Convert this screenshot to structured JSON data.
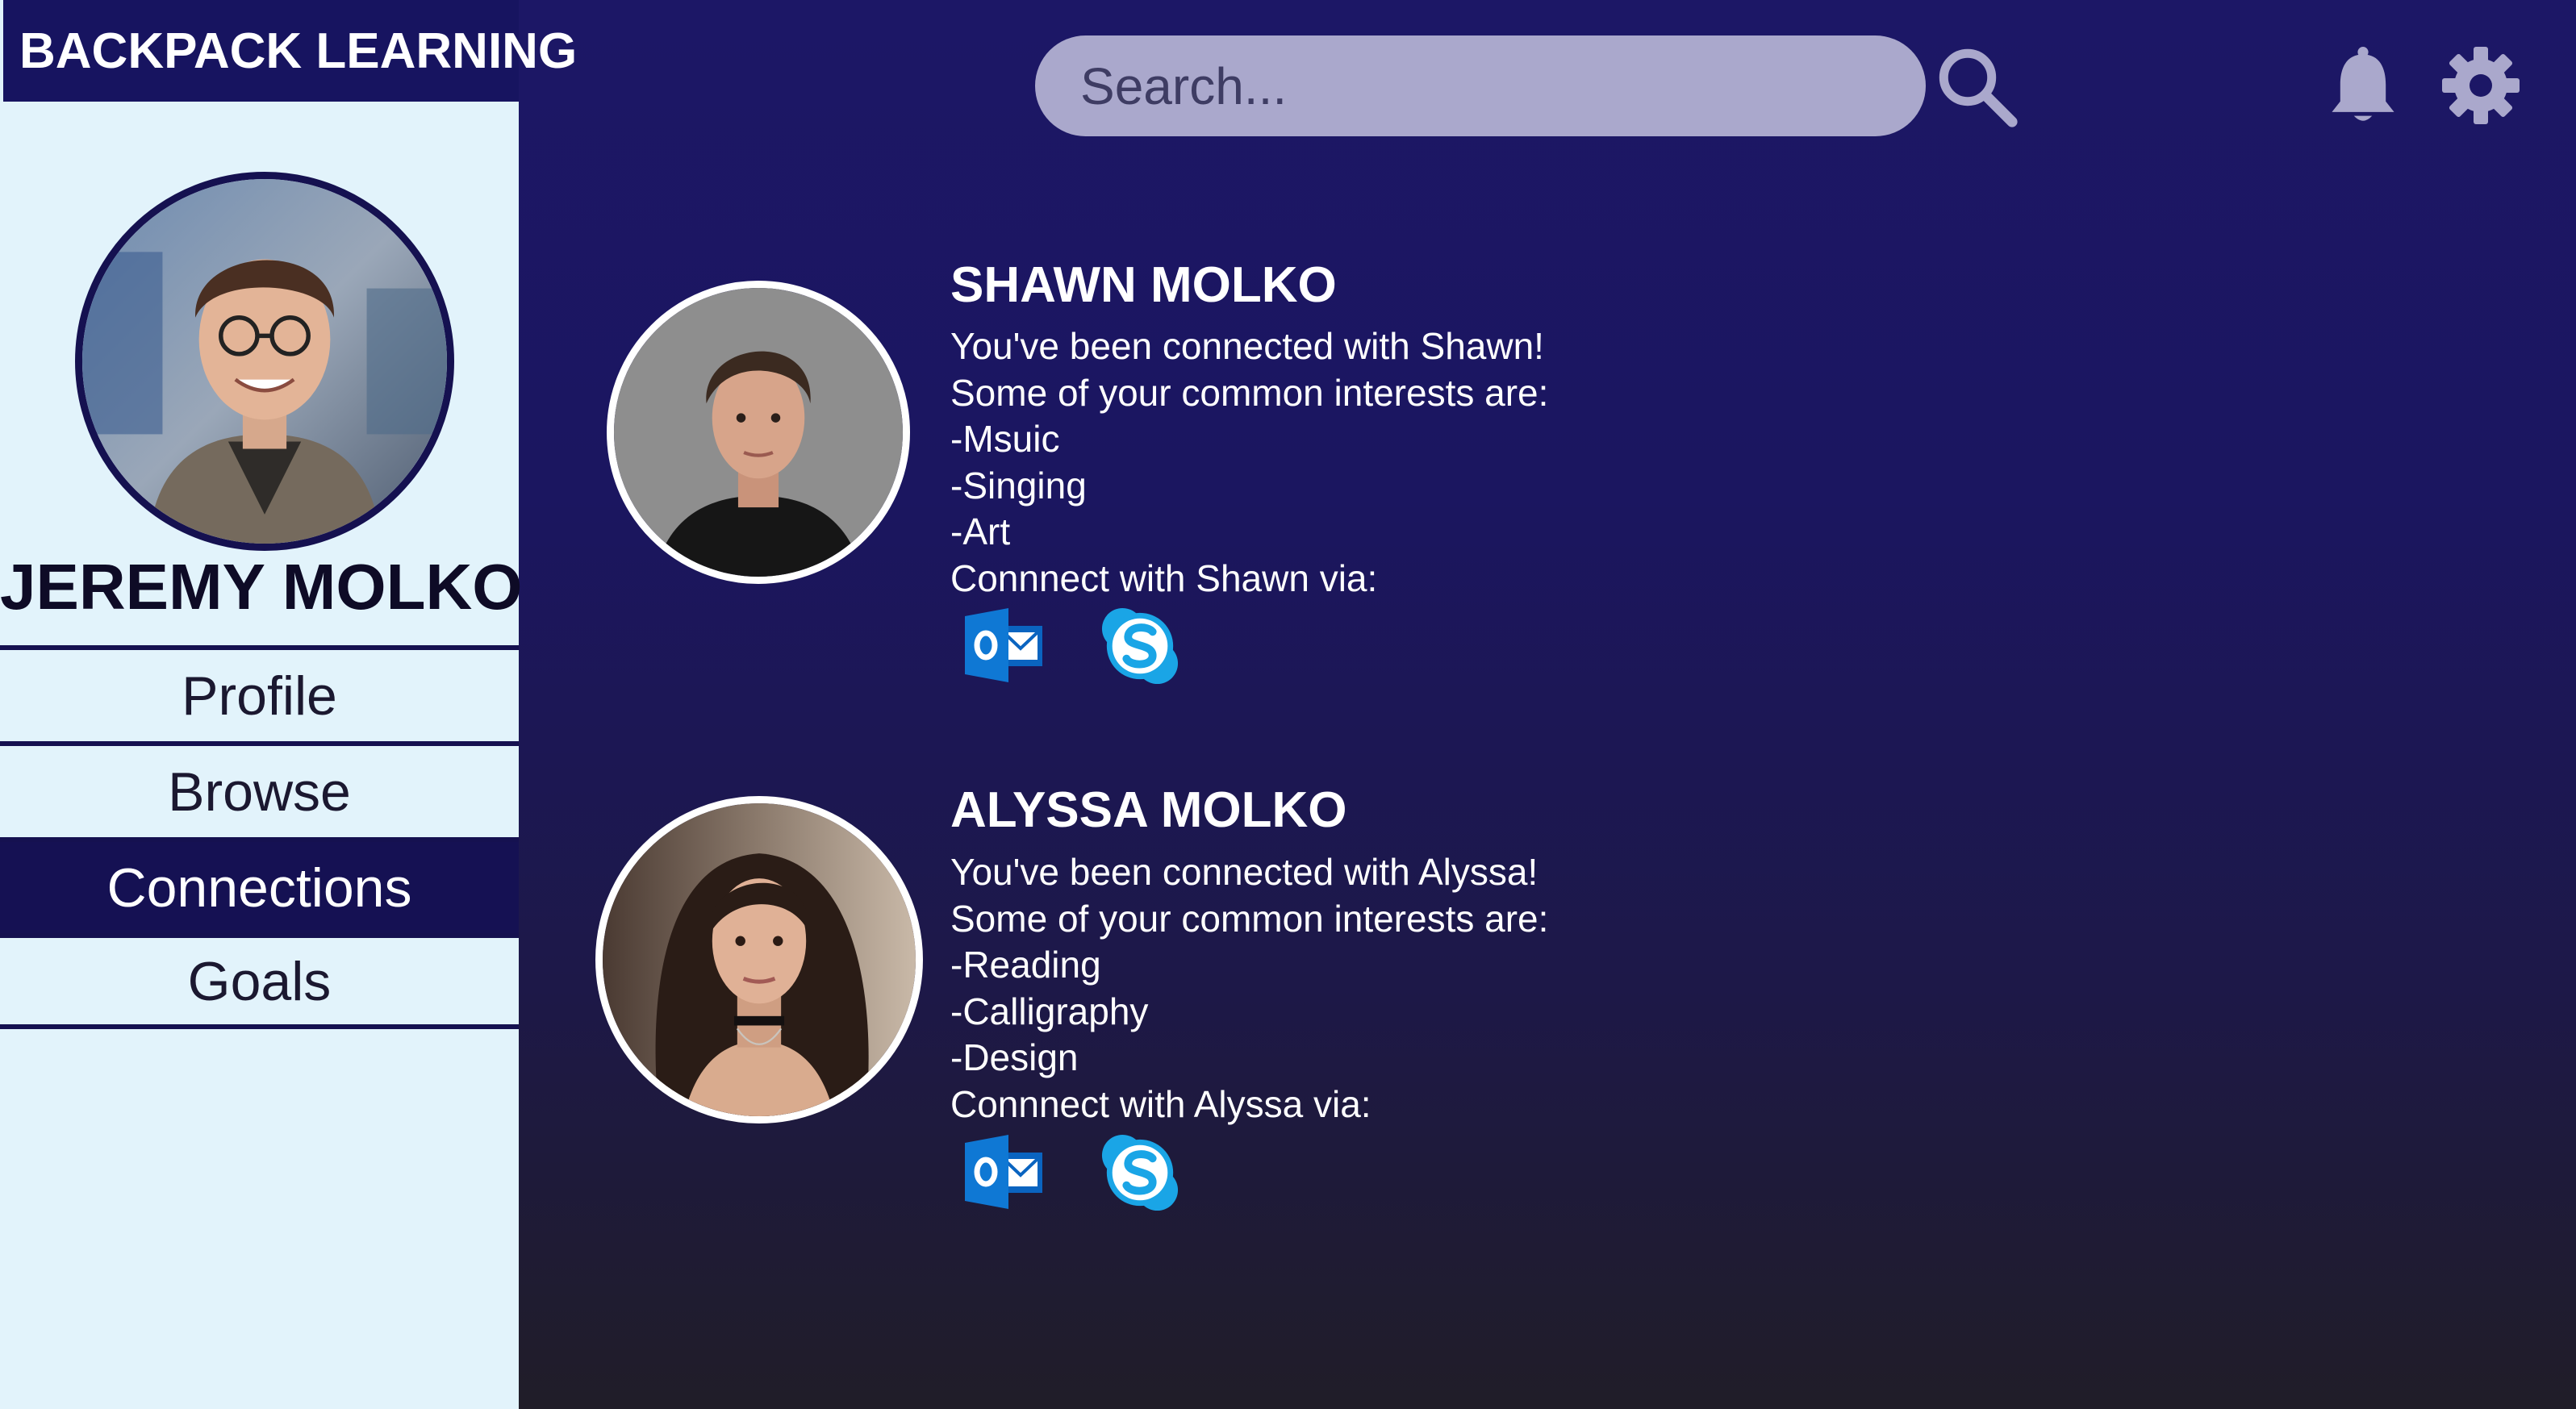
{
  "app": {
    "brand": "BACKPACK LEARNING"
  },
  "user": {
    "name": "JEREMY MOLKO"
  },
  "nav": {
    "items": [
      {
        "label": "Profile"
      },
      {
        "label": "Browse"
      },
      {
        "label": "Connections",
        "active": true
      },
      {
        "label": "Goals"
      }
    ]
  },
  "header": {
    "search_placeholder": "Search...",
    "icons": [
      "search-icon",
      "bell-icon",
      "gear-icon"
    ]
  },
  "connections": [
    {
      "name": "SHAWN MOLKO",
      "message": "You've been connected with Shawn!",
      "interests_intro": "Some of your common interests are:",
      "interests": [
        "-Msuic",
        "-Singing",
        "-Art"
      ],
      "connect_via": "Connnect with Shawn via:",
      "channels": [
        "outlook-icon",
        "skype-icon"
      ]
    },
    {
      "name": "ALYSSA MOLKO",
      "message": "You've been connected with Alyssa!",
      "interests_intro": "Some of your common interests are:",
      "interests": [
        "-Reading",
        "-Calligraphy",
        "-Design"
      ],
      "connect_via": "Connnect with Alyssa via:",
      "channels": [
        "outlook-icon",
        "skype-icon"
      ]
    }
  ],
  "colors": {
    "sidebar_bg": "#e2f3fb",
    "nav_active_bg": "#151153",
    "search_bg": "#aaa8cc",
    "outlook_blue": "#0a64c0",
    "skype_blue": "#1aa5e6"
  }
}
